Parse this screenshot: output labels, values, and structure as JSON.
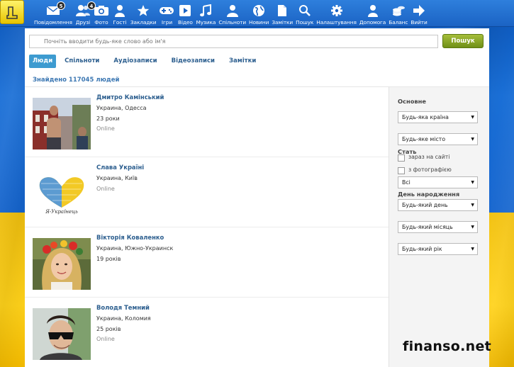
{
  "nav": [
    {
      "label": "Повідомлення",
      "icon": "envelope-icon",
      "badge": "5"
    },
    {
      "label": "Друзі",
      "icon": "friends-icon",
      "badge": "4"
    },
    {
      "label": "Фото",
      "icon": "camera-icon",
      "badge": ""
    },
    {
      "label": "Гості",
      "icon": "guest-icon",
      "badge": ""
    },
    {
      "label": "Закладки",
      "icon": "star-icon",
      "badge": ""
    },
    {
      "label": "Ігри",
      "icon": "gamepad-icon",
      "badge": ""
    },
    {
      "label": "Відео",
      "icon": "play-icon",
      "badge": ""
    },
    {
      "label": "Музика",
      "icon": "music-note-icon",
      "badge": ""
    },
    {
      "label": "Спільноти",
      "icon": "community-icon",
      "badge": ""
    },
    {
      "label": "Новини",
      "icon": "globe-icon",
      "badge": ""
    },
    {
      "label": "Замітки",
      "icon": "note-icon",
      "badge": ""
    },
    {
      "label": "Пошук",
      "icon": "magnifier-icon",
      "badge": ""
    },
    {
      "label": "Налаштування",
      "icon": "gear-icon",
      "badge": ""
    },
    {
      "label": "Допомога",
      "icon": "help-icon",
      "badge": ""
    },
    {
      "label": "Баланс",
      "icon": "coins-icon",
      "badge": ""
    },
    {
      "label": "Вийти",
      "icon": "exit-arrow-icon",
      "badge": ""
    }
  ],
  "search": {
    "placeholder": "Почніть вводити будь-яке слово або ім'я",
    "button": "Пошук"
  },
  "tabs": [
    {
      "label": "Люди",
      "active": true
    },
    {
      "label": "Спільноти",
      "active": false
    },
    {
      "label": "Аудіозаписи",
      "active": false
    },
    {
      "label": "Відеозаписи",
      "active": false
    },
    {
      "label": "Замітки",
      "active": false
    }
  ],
  "found_text": "Знайдено 117045 людей",
  "results": [
    {
      "name": "Дмитро Камінський",
      "location": "Украина, Одесса",
      "age": "23 роки",
      "status": "Online"
    },
    {
      "name": "Слава Україні",
      "location": "Украина, Київ",
      "age": "",
      "status": "Online",
      "avatar_caption": "Я-Українець"
    },
    {
      "name": "Вікторія Коваленко",
      "location": "Украина, Южно-Украинск",
      "age": "19 років",
      "status": ""
    },
    {
      "name": "Володя Темний",
      "location": "Украина, Коломия",
      "age": "25 років",
      "status": "Online"
    }
  ],
  "filters": {
    "main_heading": "Основне",
    "country": "Будь-яка країна",
    "city": "Будь-яке місто",
    "gender_heading": "Стать",
    "online_label": "зараз на сайті",
    "photo_label": "з фотографією",
    "gender_value": "Всі",
    "birthday_heading": "День народження",
    "day": "Будь-який день",
    "month": "Будь-який місяць",
    "year": "Будь-який рік"
  },
  "watermark": "finanso.net"
}
